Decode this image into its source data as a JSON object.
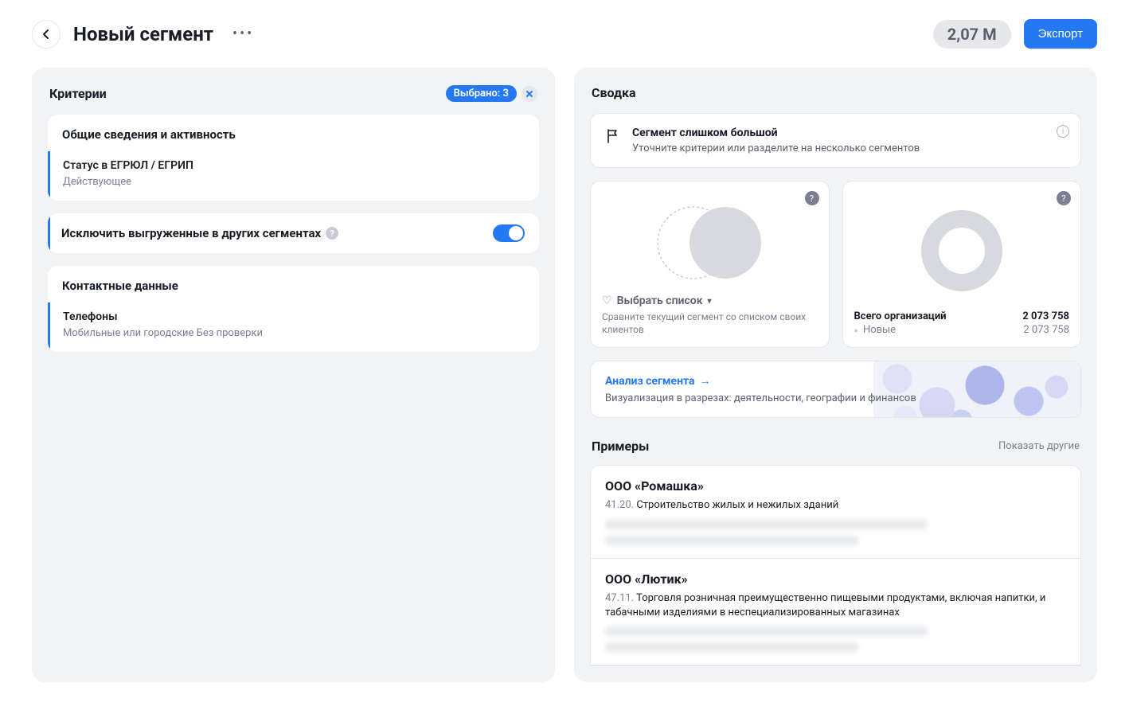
{
  "header": {
    "title": "Новый сегмент",
    "count": "2,07 М",
    "export_label": "Экспорт"
  },
  "criteria": {
    "title": "Критерии",
    "selected_label": "Выбрано: 3",
    "sections": [
      {
        "title": "Общие сведения и активность",
        "items": [
          {
            "name": "Статус в ЕГРЮЛ / ЕГРИП",
            "sub": "Действующее"
          }
        ]
      }
    ],
    "exclude_label": "Исключить выгруженные в других сегментах",
    "contact": {
      "title": "Контактные данные",
      "items": [
        {
          "name": "Телефоны",
          "sub": "Мобильные или городские\nБез проверки"
        }
      ]
    }
  },
  "summary": {
    "title": "Сводка",
    "alert": {
      "title": "Сегмент слишком большой",
      "sub": "Уточните критерии или разделите на несколько сегментов"
    },
    "compare": {
      "select_label": "Выбрать список",
      "desc": "Сравните текущий сегмент со списком своих клиентов"
    },
    "chart_data": {
      "type": "pie",
      "title": "Всего организаций",
      "total": 2073758,
      "series": [
        {
          "name": "Новые",
          "value": 2073758
        }
      ]
    },
    "donut_stats": {
      "total_label": "Всего организаций",
      "total_value": "2 073 758",
      "new_label": "Новые",
      "new_value": "2 073 758"
    },
    "analysis": {
      "link": "Анализ сегмента",
      "desc": "Визуализация в разрезах:\nдеятельности, географии и финансов"
    }
  },
  "examples": {
    "title": "Примеры",
    "show_more": "Показать другие",
    "items": [
      {
        "name": "ООО «Ромашка»",
        "code": "41.20.",
        "desc": "Строительство жилых и нежилых зданий"
      },
      {
        "name": "ООО «Лютик»",
        "code": "47.11.",
        "desc": "Торговля розничная преимущественно пищевыми продуктами, включая напитки, и табачными изделиями в неспециализированных магазинах"
      }
    ]
  }
}
